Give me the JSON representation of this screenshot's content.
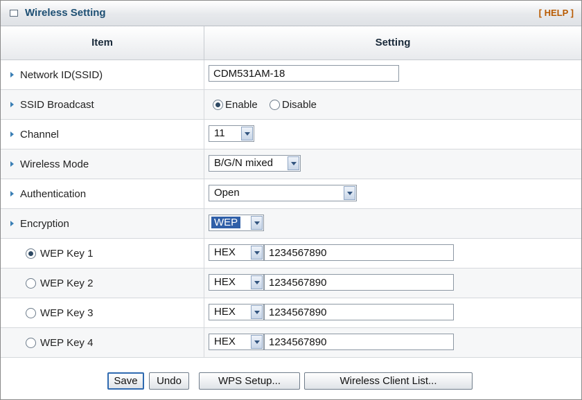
{
  "panel": {
    "title": "Wireless Setting",
    "help_label": "[ HELP ]"
  },
  "table": {
    "col_item": "Item",
    "col_setting": "Setting"
  },
  "network_id": {
    "label": "Network ID(SSID)",
    "value": "CDM531AM-18"
  },
  "ssid_broadcast": {
    "label": "SSID Broadcast",
    "options": [
      "Enable",
      "Disable"
    ],
    "selected": "Enable"
  },
  "channel": {
    "label": "Channel",
    "value": "11"
  },
  "wireless_mode": {
    "label": "Wireless Mode",
    "value": "B/G/N mixed"
  },
  "authentication": {
    "label": "Authentication",
    "value": "Open"
  },
  "encryption": {
    "label": "Encryption",
    "value": "WEP"
  },
  "wep_keys": [
    {
      "label": "WEP Key 1",
      "format": "HEX",
      "value": "1234567890",
      "selected": true
    },
    {
      "label": "WEP Key 2",
      "format": "HEX",
      "value": "1234567890",
      "selected": false
    },
    {
      "label": "WEP Key 3",
      "format": "HEX",
      "value": "1234567890",
      "selected": false
    },
    {
      "label": "WEP Key 4",
      "format": "HEX",
      "value": "1234567890",
      "selected": false
    }
  ],
  "buttons": {
    "save": "Save",
    "undo": "Undo",
    "wps": "WPS Setup...",
    "client_list": "Wireless Client List..."
  }
}
